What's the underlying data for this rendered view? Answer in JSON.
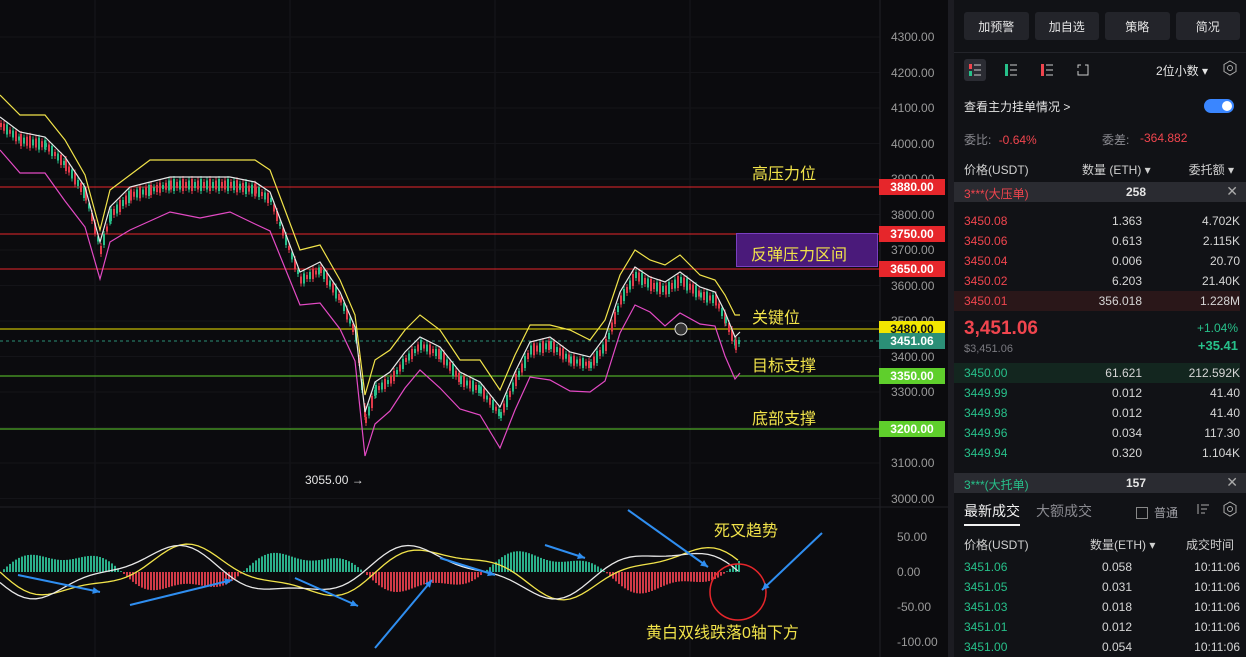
{
  "chart": {
    "y_axis_ticks": [
      "4300.00",
      "4200.00",
      "4100.00",
      "4000.00",
      "3900.00",
      "3800.00",
      "3700.00",
      "3600.00",
      "3500.00",
      "3400.00",
      "3300.00",
      "3200.00",
      "3100.00",
      "3000.00"
    ],
    "macd_ticks": [
      "50.00",
      "0.00",
      "-50.00",
      "-100.00"
    ],
    "low_marker": "3055.00 →",
    "annotations": {
      "high_pressure": "高压力位",
      "rebound_zone": "反弹压力区间",
      "key_level": "关键位",
      "target_support": "目标支撑",
      "bottom_support": "底部支撑",
      "death_cross": "死叉趋势",
      "macd_note": "黄白双线跌落0轴下方"
    },
    "price_tags": [
      {
        "value": "3880.00",
        "color": "#e6262b"
      },
      {
        "value": "3750.00",
        "color": "#e6262b"
      },
      {
        "value": "3650.00",
        "color": "#e6262b"
      },
      {
        "value": "3480.00",
        "color": "#f2e600"
      },
      {
        "value": "3451.06",
        "color": "#2b8f77"
      },
      {
        "value": "3350.00",
        "color": "#5fcf2c"
      },
      {
        "value": "3200.00",
        "color": "#5fcf2c"
      }
    ]
  },
  "panel": {
    "buttons": [
      "加预警",
      "加自选",
      "策略",
      "简况"
    ],
    "decimals": "2位小数 ▾",
    "watch_label": "查看主力挂单情况 >",
    "ratio_label": "委比:",
    "ratio_value": "-0.64%",
    "diff_label": "委差:",
    "diff_value": "-364.882",
    "headers": {
      "price": "价格(USDT)",
      "qty": "数量 (ETH) ▾",
      "total": "委托额 ▾"
    },
    "ask_big": {
      "label": "3***(大压单)",
      "value": "258",
      "close": "✕"
    },
    "asks": [
      {
        "p": "3450.08",
        "q": "1.363",
        "t": "4.702K"
      },
      {
        "p": "3450.06",
        "q": "0.613",
        "t": "2.115K"
      },
      {
        "p": "3450.04",
        "q": "0.006",
        "t": "20.70"
      },
      {
        "p": "3450.02",
        "q": "6.203",
        "t": "21.40K"
      },
      {
        "p": "3450.01",
        "q": "356.018",
        "t": "1.228M"
      }
    ],
    "last_price": "3,451.06",
    "last_price_sub": "$3,451.06",
    "change_pct": "+1.04%",
    "change_abs": "+35.41",
    "bids": [
      {
        "p": "3450.00",
        "q": "61.621",
        "t": "212.592K"
      },
      {
        "p": "3449.99",
        "q": "0.012",
        "t": "41.40"
      },
      {
        "p": "3449.98",
        "q": "0.012",
        "t": "41.40"
      },
      {
        "p": "3449.96",
        "q": "0.034",
        "t": "117.30"
      },
      {
        "p": "3449.94",
        "q": "0.320",
        "t": "1.104K"
      }
    ],
    "bid_big": {
      "label": "3***(大托单)",
      "value": "157",
      "close": "✕"
    },
    "tabs": [
      "最新成交",
      "大额成交"
    ],
    "checkbox_label": "普通",
    "trade_headers": {
      "price": "价格(USDT)",
      "qty": "数量(ETH) ▾",
      "time": "成交时间"
    },
    "trades": [
      {
        "p": "3451.06",
        "q": "0.058",
        "t": "10:11:06"
      },
      {
        "p": "3451.05",
        "q": "0.031",
        "t": "10:11:06"
      },
      {
        "p": "3451.03",
        "q": "0.018",
        "t": "10:11:06"
      },
      {
        "p": "3451.01",
        "q": "0.012",
        "t": "10:11:06"
      },
      {
        "p": "3451.00",
        "q": "0.054",
        "t": "10:11:06"
      }
    ]
  }
}
